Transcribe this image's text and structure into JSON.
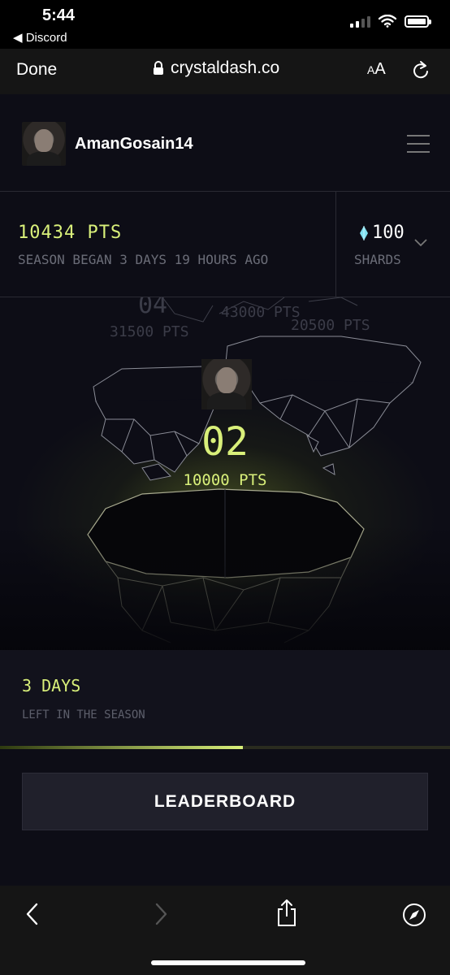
{
  "status_bar": {
    "time": "5:44",
    "back_app": "◀ Discord"
  },
  "browser": {
    "done_label": "Done",
    "url": "crystaldash.co",
    "text_size_small": "A",
    "text_size_large": "A"
  },
  "user": {
    "username": "AmanGosain14"
  },
  "stats": {
    "points": "10434 PTS",
    "season_began": "SEASON BEGAN 3 DAYS 19 HOURS AGO",
    "shards_value": "100",
    "shards_label": "SHARDS"
  },
  "arena": {
    "rank_04": "04",
    "pts_04": "31500 PTS",
    "pts_01": "43000 PTS",
    "pts_03": "20500 PTS",
    "current_rank": "02",
    "current_pts": "10000 PTS"
  },
  "season": {
    "days_left": "3 DAYS",
    "days_left_label": "LEFT IN THE SEASON",
    "progress_fraction": 0.54
  },
  "actions": {
    "leaderboard_label": "LEADERBOARD"
  },
  "icons": {
    "lock": "lock-icon",
    "reload": "reload-icon",
    "menu": "hamburger-menu-icon",
    "shard": "diamond-icon",
    "chevron": "chevron-down-icon",
    "back": "chevron-left-icon",
    "forward": "chevron-right-icon",
    "share": "share-icon",
    "compass": "compass-icon"
  },
  "colors": {
    "accent": "#d9f07a",
    "background": "#0d0d16"
  }
}
